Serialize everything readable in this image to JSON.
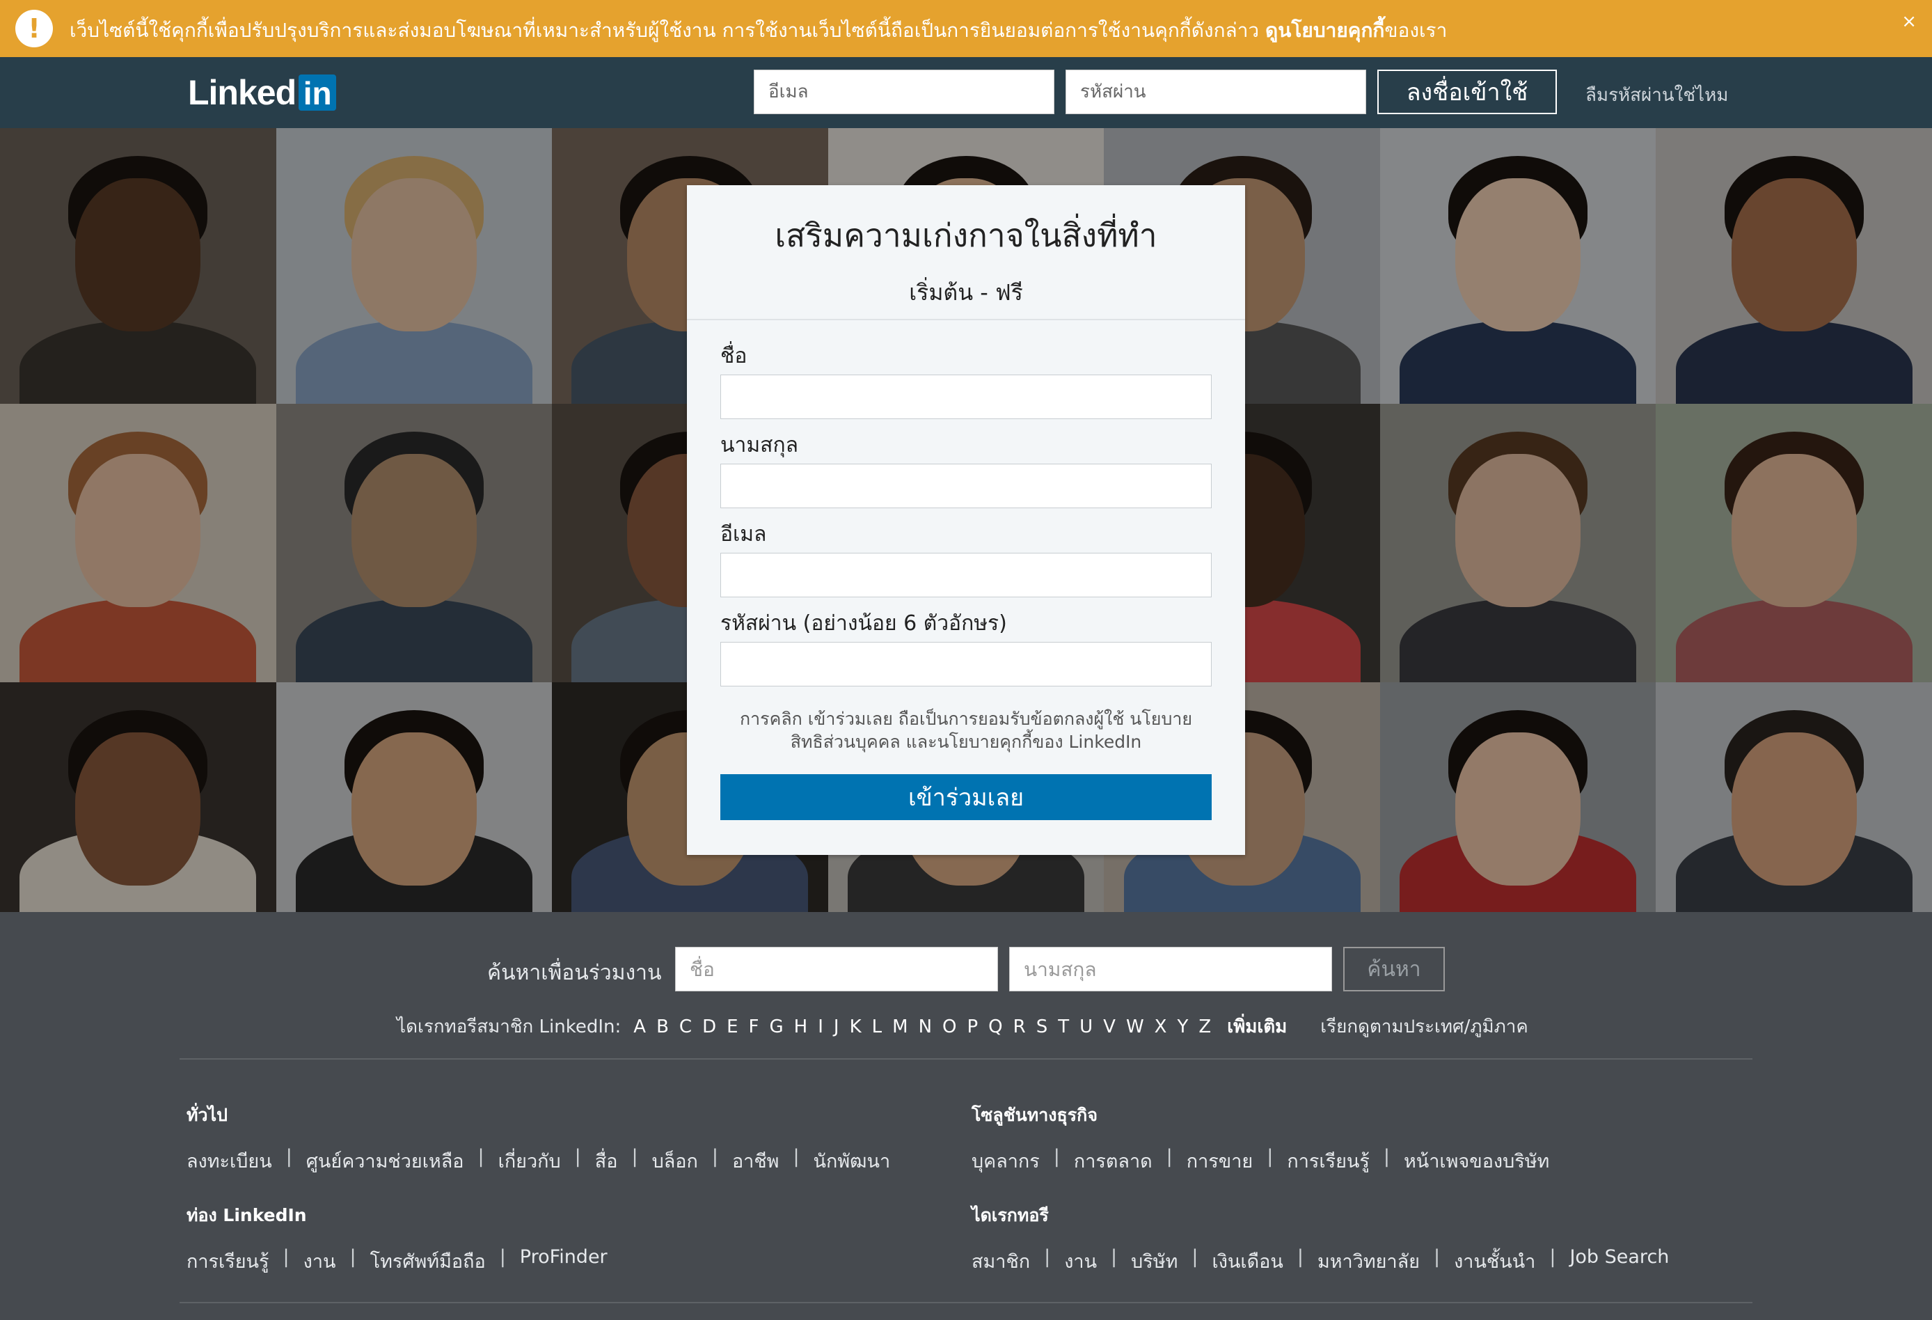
{
  "cookie_banner": {
    "text": "เว็บไซต์นี้ใช้คุกกี้เพื่อปรับปรุงบริการและส่งมอบโฆษณาที่เหมาะสำหรับผู้ใช้งาน การใช้งานเว็บไซต์นี้ถือเป็นการยินยอมต่อการใช้งานคุกกี้ดังกล่าว",
    "link": "ดูนโยบายคุกกี้",
    "suffix": "ของเรา",
    "close": "×",
    "badge": "!"
  },
  "header": {
    "logo_linked": "Linked",
    "logo_in": "in",
    "email_placeholder": "อีเมล",
    "password_placeholder": "รหัสผ่าน",
    "login_button": "ลงชื่อเข้าใช้",
    "forgot_password": "ลืมรหัสผ่านใช่ไหม"
  },
  "join_card": {
    "title": "เสริมความเก่งกาจในสิ่งที่ทำ",
    "subtitle": "เริ่มต้น - ฟรี",
    "first_name_label": "ชื่อ",
    "last_name_label": "นามสกุล",
    "email_label": "อีเมล",
    "password_label": "รหัสผ่าน (อย่างน้อย 6 ตัวอักษร)",
    "terms_line1": "การคลิก เข้าร่วมเลย ถือเป็นการยอมรับข้อตกลงผู้ใช้ นโยบาย",
    "terms_line2": "สิทธิส่วนบุคคล และนโยบายคุกกี้ของ LinkedIn",
    "join_button": "เข้าร่วมเลย"
  },
  "footer": {
    "search": {
      "label": "ค้นหาเพื่อนร่วมงาน",
      "first_placeholder": "ชื่อ",
      "last_placeholder": "นามสกุล",
      "button": "ค้นหา"
    },
    "directory": {
      "label": "ไดเรกทอรีสมาชิก LinkedIn:",
      "letters": [
        "A",
        "B",
        "C",
        "D",
        "E",
        "F",
        "G",
        "H",
        "I",
        "J",
        "K",
        "L",
        "M",
        "N",
        "O",
        "P",
        "Q",
        "R",
        "S",
        "T",
        "U",
        "V",
        "W",
        "X",
        "Y",
        "Z"
      ],
      "more": "เพิ่มเติม",
      "by_country": "เรียกดูตามประเทศ/ภูมิภาค"
    },
    "general": {
      "title": "ทั่วไป",
      "links": [
        "ลงทะเบียน",
        "ศูนย์ความช่วยเหลือ",
        "เกี่ยวกับ",
        "สื่อ",
        "บล็อก",
        "อาชีพ",
        "นักพัฒนา"
      ]
    },
    "business": {
      "title": "โซลูชันทางธุรกิจ",
      "links": [
        "บุคลากร",
        "การตลาด",
        "การขาย",
        "การเรียนรู้",
        "หน้าเพจของบริษัท"
      ]
    },
    "browse": {
      "title": "ท่อง LinkedIn",
      "links": [
        "การเรียนรู้",
        "งาน",
        "โทรศัพท์มือถือ",
        "ProFinder"
      ]
    },
    "directories": {
      "title": "ไดเรกทอรี",
      "links": [
        "สมาชิก",
        "งาน",
        "บริษัท",
        "เงินเดือน",
        "มหาวิทยาลัย",
        "งานชั้นนำ",
        "Job Search"
      ]
    }
  },
  "colors": {
    "banner": "#e5a22e",
    "header": "#283e4a",
    "brand_blue": "#0073b1",
    "footer": "#464a4f"
  }
}
